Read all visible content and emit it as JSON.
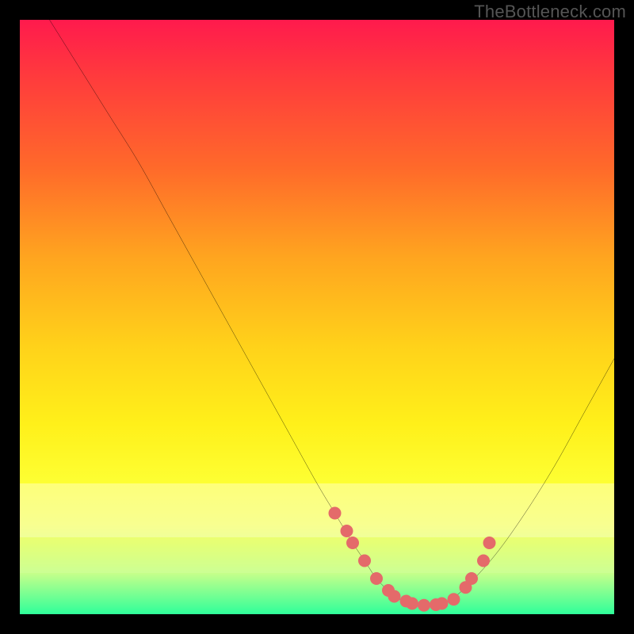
{
  "attribution": "TheBottleneck.com",
  "chart_data": {
    "type": "line",
    "title": "",
    "xlabel": "",
    "ylabel": "",
    "xlim": [
      0,
      100
    ],
    "ylim": [
      0,
      100
    ],
    "grid": false,
    "series": [
      {
        "name": "bottleneck-curve",
        "x": [
          5,
          10,
          15,
          20,
          25,
          30,
          35,
          40,
          45,
          50,
          53,
          56,
          58,
          60,
          62,
          64,
          66,
          68,
          70,
          72,
          75,
          80,
          85,
          90,
          95,
          100
        ],
        "values": [
          100,
          92,
          84,
          76,
          67,
          58,
          49,
          40,
          31,
          22,
          17,
          12,
          9,
          6,
          4,
          2.5,
          1.8,
          1.5,
          1.6,
          2.2,
          4.5,
          10,
          17,
          25,
          34,
          43
        ]
      }
    ],
    "markers": {
      "name": "fit-markers",
      "x": [
        53,
        55,
        56,
        58,
        60,
        62,
        63,
        65,
        66,
        68,
        70,
        71,
        73,
        75,
        76,
        78,
        79
      ],
      "values": [
        17,
        14,
        12,
        9,
        6,
        4,
        3,
        2.2,
        1.8,
        1.5,
        1.6,
        1.8,
        2.5,
        4.5,
        6,
        9,
        12
      ],
      "color": "#e46a6a",
      "radius": 8
    }
  }
}
